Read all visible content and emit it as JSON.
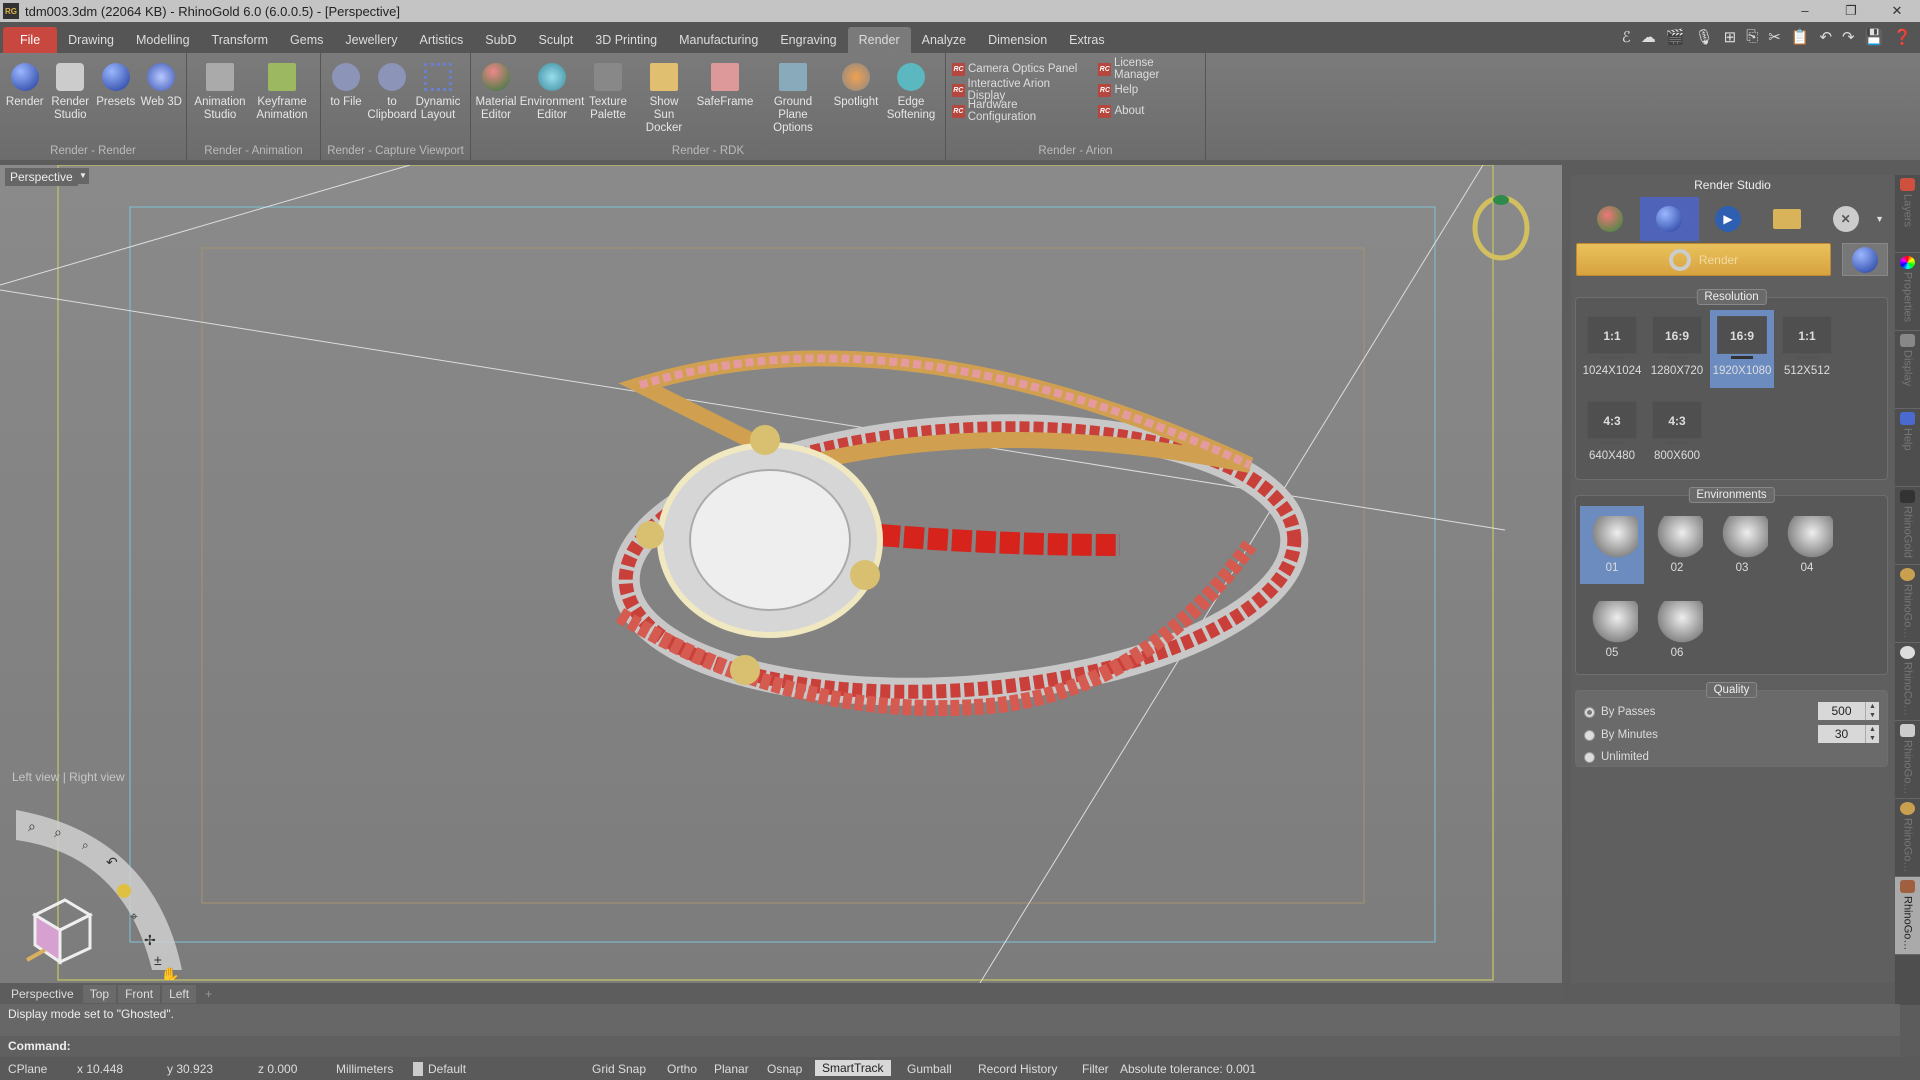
{
  "window": {
    "title": "tdm003.3dm (22064 KB) - RhinoGold 6.0 (6.0.0.5) - [Perspective]",
    "logo": "RG",
    "controls": [
      "–",
      "❐",
      "✕"
    ]
  },
  "menu": {
    "tabs": [
      "File",
      "Drawing",
      "Modelling",
      "Transform",
      "Gems",
      "Jewellery",
      "Artistics",
      "SubD",
      "Sculpt",
      "3D Printing",
      "Manufacturing",
      "Engraving",
      "Render",
      "Analyze",
      "Dimension",
      "Extras"
    ],
    "active": "Render"
  },
  "quick_access": [
    "edit-curve-icon",
    "cloud-icon",
    "clapperboard-icon",
    "microphone-icon",
    "zoom-add-icon",
    "copy-icon",
    "cut-icon",
    "paste-icon",
    "undo-icon",
    "redo-icon",
    "save-icon",
    "help-icon"
  ],
  "ribbon": {
    "groups": [
      {
        "label": "Render - Render",
        "buttons": [
          "Render",
          "Render Studio",
          "Presets",
          "Web 3D"
        ]
      },
      {
        "label": "Render - Animation",
        "buttons": [
          "Animation Studio",
          "Keyframe Animation"
        ]
      },
      {
        "label": "Render - Capture Viewport",
        "buttons": [
          "to File",
          "to Clipboard",
          "Dynamic Layout"
        ]
      },
      {
        "label": "Render - RDK",
        "buttons": [
          "Material Editor",
          "Environment Editor",
          "Texture Palette",
          "Show Sun Docker",
          "SafeFrame",
          "Ground Plane Options",
          "Spotlight",
          "Edge Softening"
        ]
      },
      {
        "label": "Render - Arion",
        "links": [
          "Camera Optics Panel",
          "Interactive Arion Display",
          "Hardware Configuration",
          "License Manager",
          "Help",
          "About"
        ],
        "badge": "RC"
      }
    ]
  },
  "viewport": {
    "label": "Perspective",
    "nav_hint": "Left view | Right view",
    "display_mode": "Ghosted"
  },
  "render_studio": {
    "title": "Render Studio",
    "render_label": "Render",
    "resolution": {
      "title": "Resolution",
      "items": [
        {
          "ratio": "1:1",
          "size": "1024X1024"
        },
        {
          "ratio": "16:9",
          "size": "1280X720"
        },
        {
          "ratio": "16:9",
          "size": "1920X1080",
          "selected": true
        },
        {
          "ratio": "1:1",
          "size": "512X512"
        },
        {
          "ratio": "4:3",
          "size": "640X480"
        },
        {
          "ratio": "4:3",
          "size": "800X600"
        }
      ]
    },
    "environments": {
      "title": "Environments",
      "items": [
        "01",
        "02",
        "03",
        "04",
        "05",
        "06"
      ],
      "selected": "01"
    },
    "quality": {
      "title": "Quality",
      "options": [
        "By Passes",
        "By Minutes",
        "Unlimited"
      ],
      "selected": "By Passes",
      "passes": "500",
      "minutes": "30"
    }
  },
  "side_tabs": [
    "Layers",
    "Properties",
    "Display",
    "Help",
    "RhinoGold",
    "RhinoGo…",
    "RhinoCo…",
    "RhinoGo…",
    "RhinoGo…",
    "RhinoGo…"
  ],
  "viewport_tabs": [
    "Perspective",
    "Top",
    "Front",
    "Left",
    "+"
  ],
  "command": {
    "history": "Display mode set to \"Ghosted\".",
    "prompt": "Command:"
  },
  "status": {
    "cplane": "CPlane",
    "x": "x 10.448",
    "y": "y 30.923",
    "z": "z 0.000",
    "units": "Millimeters",
    "layer": "Default",
    "toggles": [
      "Grid Snap",
      "Ortho",
      "Planar",
      "Osnap",
      "SmartTrack",
      "Gumball",
      "Record History",
      "Filter"
    ],
    "active_toggle": "SmartTrack",
    "tolerance": "Absolute tolerance: 0.001"
  },
  "colors": {
    "file_tab": "#c8473e",
    "render_button": "#e2b550",
    "selection": "#6c8cc0",
    "toolbar_selected": "#4f63b8"
  }
}
